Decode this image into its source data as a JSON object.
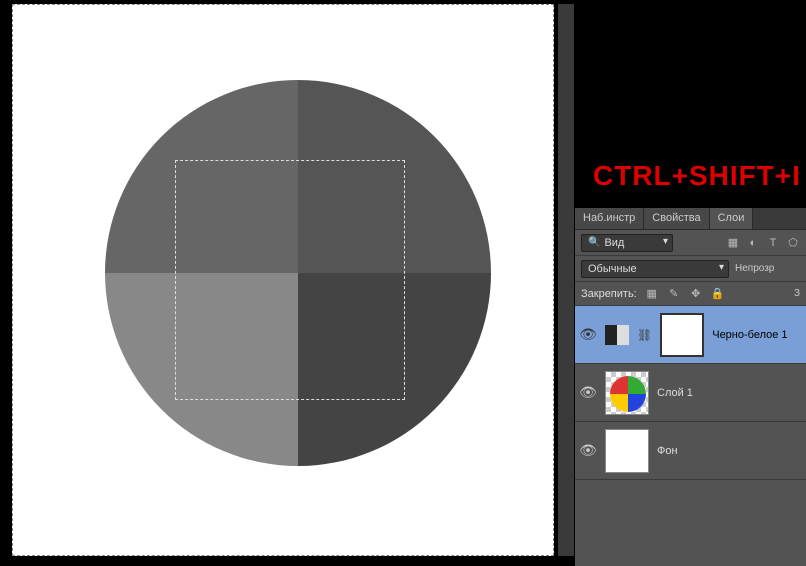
{
  "hotkey": "CTRL+SHIFT+I",
  "panel": {
    "tabs": [
      "Наб.инстр",
      "Свойства",
      "Слои"
    ],
    "active_tab": 2,
    "filter": {
      "view_label": "Вид"
    },
    "type_icons": [
      "image-icon",
      "adjustment-icon",
      "type-icon",
      "shape-icon"
    ],
    "blend_mode": "Обычные",
    "opacity_label": "Непрозр",
    "lock_label": "Закрепить:",
    "fill_label": "З",
    "layers": [
      {
        "name": "Черно-белое 1",
        "type": "adjustment",
        "selected": true
      },
      {
        "name": "Слой 1",
        "type": "pixel",
        "selected": false
      },
      {
        "name": "Фон",
        "type": "background",
        "selected": false
      }
    ]
  }
}
